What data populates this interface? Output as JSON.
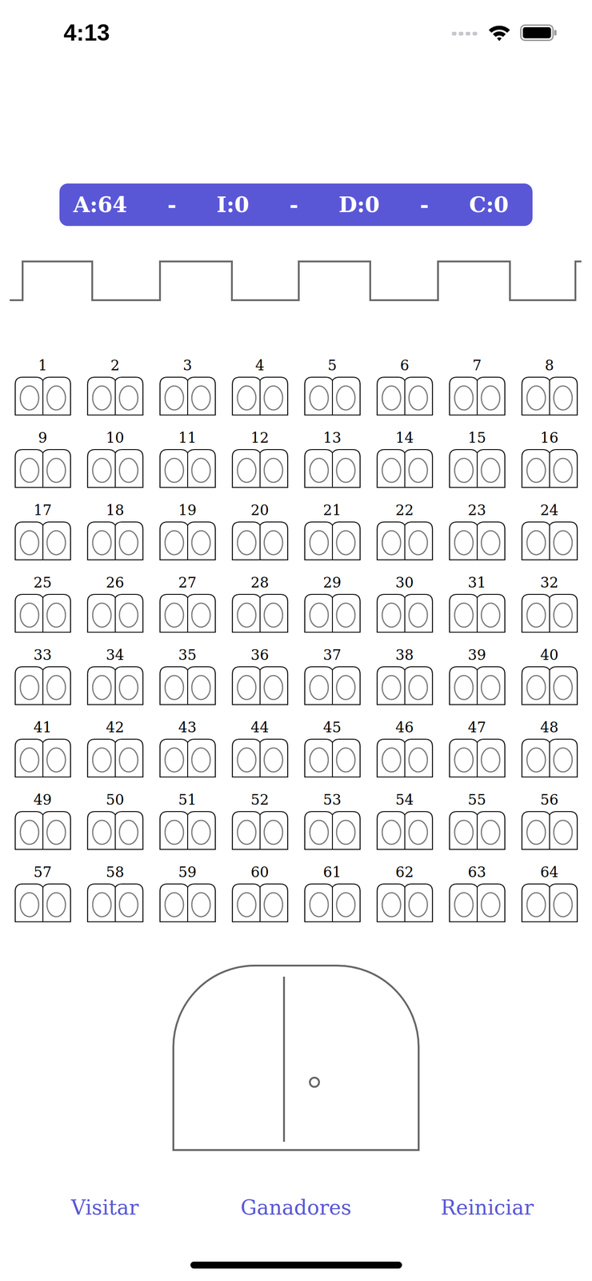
{
  "status_bar": {
    "time": "4:13"
  },
  "counters": [
    {
      "label": "A:64"
    },
    {
      "label": "I:0"
    },
    {
      "label": "D:0"
    },
    {
      "label": "C:0"
    }
  ],
  "separator": "-",
  "doors": [
    {
      "number": "1",
      "open": false
    },
    {
      "number": "2",
      "open": false
    },
    {
      "number": "3",
      "open": false
    },
    {
      "number": "4",
      "open": false
    },
    {
      "number": "5",
      "open": false
    },
    {
      "number": "6",
      "open": false
    },
    {
      "number": "7",
      "open": false
    },
    {
      "number": "8",
      "open": false
    },
    {
      "number": "9",
      "open": false
    },
    {
      "number": "10",
      "open": false
    },
    {
      "number": "11",
      "open": false
    },
    {
      "number": "12",
      "open": false
    },
    {
      "number": "13",
      "open": false
    },
    {
      "number": "14",
      "open": false
    },
    {
      "number": "15",
      "open": false
    },
    {
      "number": "16",
      "open": false
    },
    {
      "number": "17",
      "open": false
    },
    {
      "number": "18",
      "open": false
    },
    {
      "number": "19",
      "open": false
    },
    {
      "number": "20",
      "open": false
    },
    {
      "number": "21",
      "open": false
    },
    {
      "number": "22",
      "open": false
    },
    {
      "number": "23",
      "open": false
    },
    {
      "number": "24",
      "open": false
    },
    {
      "number": "25",
      "open": false
    },
    {
      "number": "26",
      "open": false
    },
    {
      "number": "27",
      "open": false
    },
    {
      "number": "28",
      "open": false
    },
    {
      "number": "29",
      "open": false
    },
    {
      "number": "30",
      "open": false
    },
    {
      "number": "31",
      "open": false
    },
    {
      "number": "32",
      "open": false
    },
    {
      "number": "33",
      "open": false
    },
    {
      "number": "34",
      "open": false
    },
    {
      "number": "35",
      "open": false
    },
    {
      "number": "36",
      "open": false
    },
    {
      "number": "37",
      "open": false
    },
    {
      "number": "38",
      "open": false
    },
    {
      "number": "39",
      "open": false
    },
    {
      "number": "40",
      "open": false
    },
    {
      "number": "41",
      "open": false
    },
    {
      "number": "42",
      "open": false
    },
    {
      "number": "43",
      "open": false
    },
    {
      "number": "44",
      "open": false
    },
    {
      "number": "45",
      "open": false
    },
    {
      "number": "46",
      "open": false
    },
    {
      "number": "47",
      "open": false
    },
    {
      "number": "48",
      "open": false
    },
    {
      "number": "49",
      "open": false
    },
    {
      "number": "50",
      "open": false
    },
    {
      "number": "51",
      "open": false
    },
    {
      "number": "52",
      "open": false
    },
    {
      "number": "53",
      "open": false
    },
    {
      "number": "54",
      "open": false
    },
    {
      "number": "55",
      "open": false
    },
    {
      "number": "56",
      "open": false
    },
    {
      "number": "57",
      "open": false
    },
    {
      "number": "58",
      "open": false
    },
    {
      "number": "59",
      "open": false
    },
    {
      "number": "60",
      "open": false
    },
    {
      "number": "61",
      "open": false
    },
    {
      "number": "62",
      "open": false
    },
    {
      "number": "63",
      "open": false
    },
    {
      "number": "64",
      "open": false
    }
  ],
  "main_door": {
    "open": false
  },
  "buttons": [
    "Visitar",
    "Ganadores",
    "Reiniciar"
  ]
}
